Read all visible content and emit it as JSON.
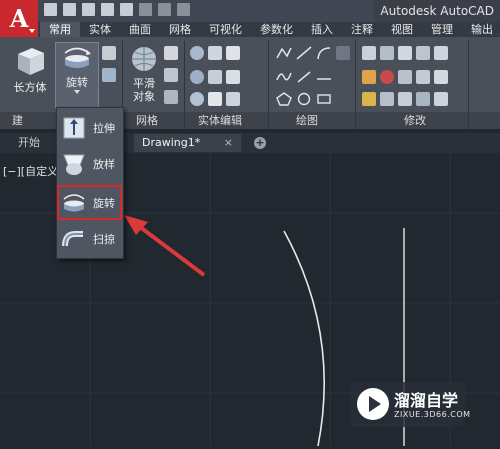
{
  "app": {
    "title": "Autodesk AutoCAD",
    "logo_letter": "A"
  },
  "ribbon_tabs": [
    "常用",
    "实体",
    "曲面",
    "网格",
    "可视化",
    "参数化",
    "插入",
    "注释",
    "视图",
    "管理",
    "输出"
  ],
  "active_tab": "常用",
  "buttons": {
    "box": "长方体",
    "revolve": "旋转",
    "smooth_line1": "平滑",
    "smooth_line2": "对象"
  },
  "panels": {
    "modeling": "建",
    "mesh": "网格",
    "solid_edit": "实体编辑",
    "draw": "绘图",
    "modify": "修改"
  },
  "flyout_items": [
    "拉伸",
    "放样",
    "旋转",
    "扫掠"
  ],
  "file_tabs": {
    "start": "开始",
    "drawing": "Drawing1*",
    "close": "×",
    "plus": "+"
  },
  "viewport_label": "[−][自定义",
  "watermark": {
    "title": "溜溜自学",
    "url": "ZIXUE.3D66.COM"
  },
  "colors": {
    "app_red": "#c8282e",
    "highlight": "#d52a2a",
    "arrow": "#d93a3a"
  }
}
